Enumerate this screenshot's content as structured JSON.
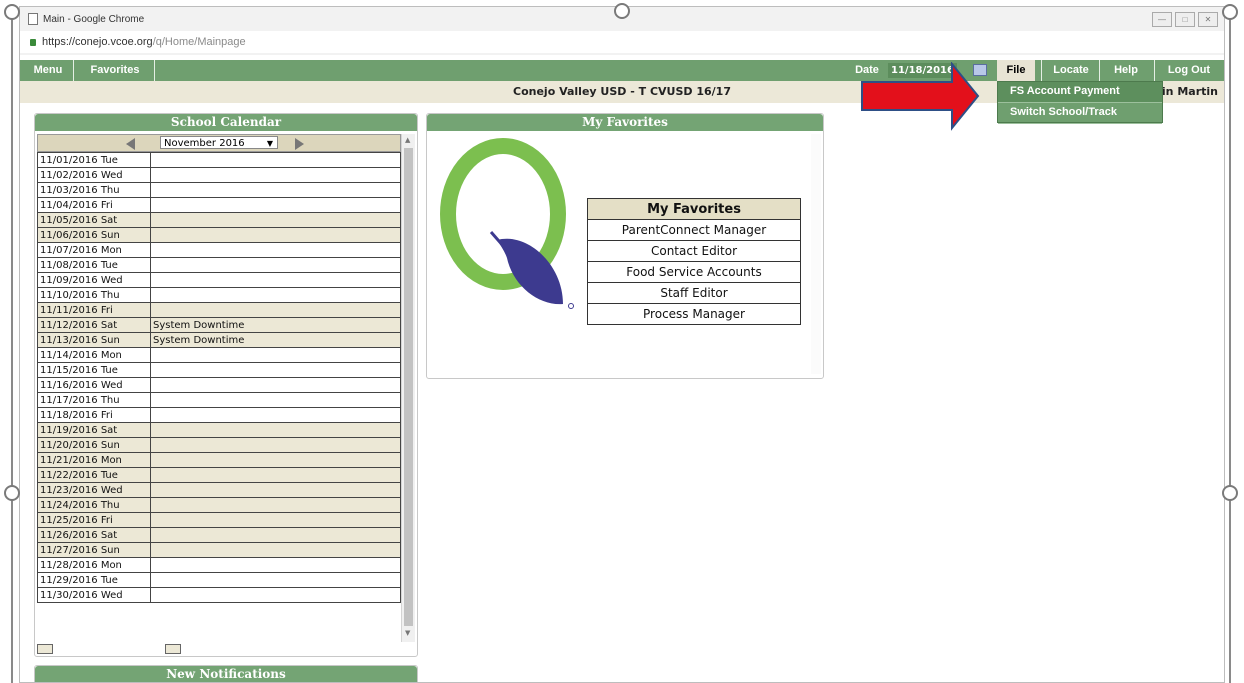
{
  "window": {
    "title": "Main - Google Chrome",
    "url_host": "https://conejo.vcoe.org",
    "url_path": "/q/Home/Mainpage"
  },
  "nav": {
    "menu": "Menu",
    "favorites": "Favorites",
    "date_label": "Date",
    "date_value": "11/18/2016",
    "file": "File",
    "locate": "Locate",
    "help": "Help",
    "logout": "Log Out"
  },
  "header": {
    "district": "Conejo Valley USD - T CVUSD 16/17",
    "user": "in Martin"
  },
  "file_menu": {
    "items": [
      "FS Account Payment",
      "Switch School/Track"
    ]
  },
  "calendar": {
    "title": "School Calendar",
    "month": "November 2016",
    "rows": [
      {
        "date": "11/01/2016 Tue",
        "note": "",
        "weekend": false
      },
      {
        "date": "11/02/2016 Wed",
        "note": "",
        "weekend": false
      },
      {
        "date": "11/03/2016 Thu",
        "note": "",
        "weekend": false
      },
      {
        "date": "11/04/2016 Fri",
        "note": "",
        "weekend": false
      },
      {
        "date": "11/05/2016 Sat",
        "note": "",
        "weekend": true
      },
      {
        "date": "11/06/2016 Sun",
        "note": "",
        "weekend": true
      },
      {
        "date": "11/07/2016 Mon",
        "note": "",
        "weekend": false
      },
      {
        "date": "11/08/2016 Tue",
        "note": "",
        "weekend": false
      },
      {
        "date": "11/09/2016 Wed",
        "note": "",
        "weekend": false
      },
      {
        "date": "11/10/2016 Thu",
        "note": "",
        "weekend": false
      },
      {
        "date": "11/11/2016 Fri",
        "note": "",
        "weekend": true
      },
      {
        "date": "11/12/2016 Sat",
        "note": "System Downtime",
        "weekend": true
      },
      {
        "date": "11/13/2016 Sun",
        "note": "System Downtime",
        "weekend": true
      },
      {
        "date": "11/14/2016 Mon",
        "note": "",
        "weekend": false
      },
      {
        "date": "11/15/2016 Tue",
        "note": "",
        "weekend": false
      },
      {
        "date": "11/16/2016 Wed",
        "note": "",
        "weekend": false
      },
      {
        "date": "11/17/2016 Thu",
        "note": "",
        "weekend": false
      },
      {
        "date": "11/18/2016 Fri",
        "note": "",
        "weekend": false
      },
      {
        "date": "11/19/2016 Sat",
        "note": "",
        "weekend": true
      },
      {
        "date": "11/20/2016 Sun",
        "note": "",
        "weekend": true
      },
      {
        "date": "11/21/2016 Mon",
        "note": "",
        "weekend": true
      },
      {
        "date": "11/22/2016 Tue",
        "note": "",
        "weekend": true
      },
      {
        "date": "11/23/2016 Wed",
        "note": "",
        "weekend": true
      },
      {
        "date": "11/24/2016 Thu",
        "note": "",
        "weekend": true
      },
      {
        "date": "11/25/2016 Fri",
        "note": "",
        "weekend": true
      },
      {
        "date": "11/26/2016 Sat",
        "note": "",
        "weekend": true
      },
      {
        "date": "11/27/2016 Sun",
        "note": "",
        "weekend": true
      },
      {
        "date": "11/28/2016 Mon",
        "note": "",
        "weekend": false
      },
      {
        "date": "11/29/2016 Tue",
        "note": "",
        "weekend": false
      },
      {
        "date": "11/30/2016 Wed",
        "note": "",
        "weekend": false
      }
    ]
  },
  "favorites_panel": {
    "title": "My Favorites",
    "table_header": "My Favorites",
    "items": [
      "ParentConnect Manager",
      "Contact Editor",
      "Food Service Accounts",
      "Staff Editor",
      "Process Manager"
    ]
  },
  "notifications": {
    "title": "New Notifications"
  },
  "colors": {
    "nav_green": "#6f9f6f",
    "panel_green": "#74a474",
    "beige": "#ece8d6",
    "logo_green": "#7cbf4f",
    "logo_leaf": "#3d3a8f",
    "arrow_red": "#e3101b"
  },
  "icons": {
    "lock": "lock-icon",
    "calendar": "calendar-icon",
    "prev": "arrow-left-icon",
    "next": "arrow-right-icon",
    "logo": "q-leaf-logo"
  }
}
